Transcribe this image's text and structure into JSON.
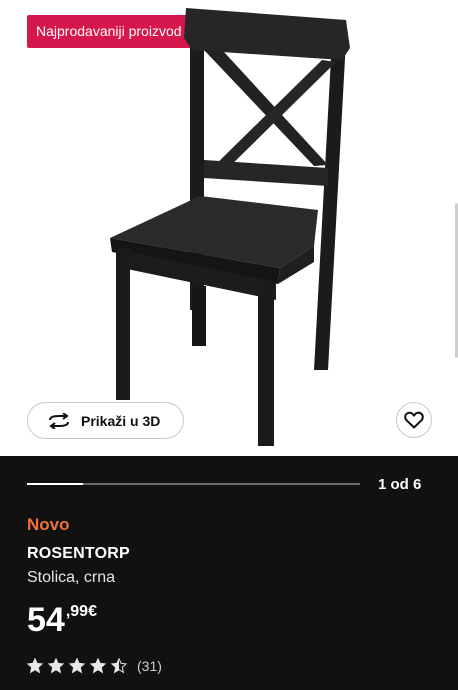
{
  "badge": {
    "label": "Najprodavaniji proizvod",
    "color": "#d6174d"
  },
  "gallery": {
    "current": 1,
    "total": 6,
    "counter_text": "1 od 6",
    "progress_fraction": 0.1667
  },
  "actions": {
    "view_3d_label": "Prikaži u 3D",
    "view_3d_icon": "rotate-3d-icon",
    "favorite_icon": "heart-icon"
  },
  "product": {
    "tag": "Novo",
    "tag_color": "#f0703a",
    "name": "ROSENTORP",
    "description": "Stolica, crna",
    "price_int": "54",
    "price_dec": ",99€",
    "rating_value": 4.5,
    "rating_max": 5,
    "review_count": "(31)"
  }
}
